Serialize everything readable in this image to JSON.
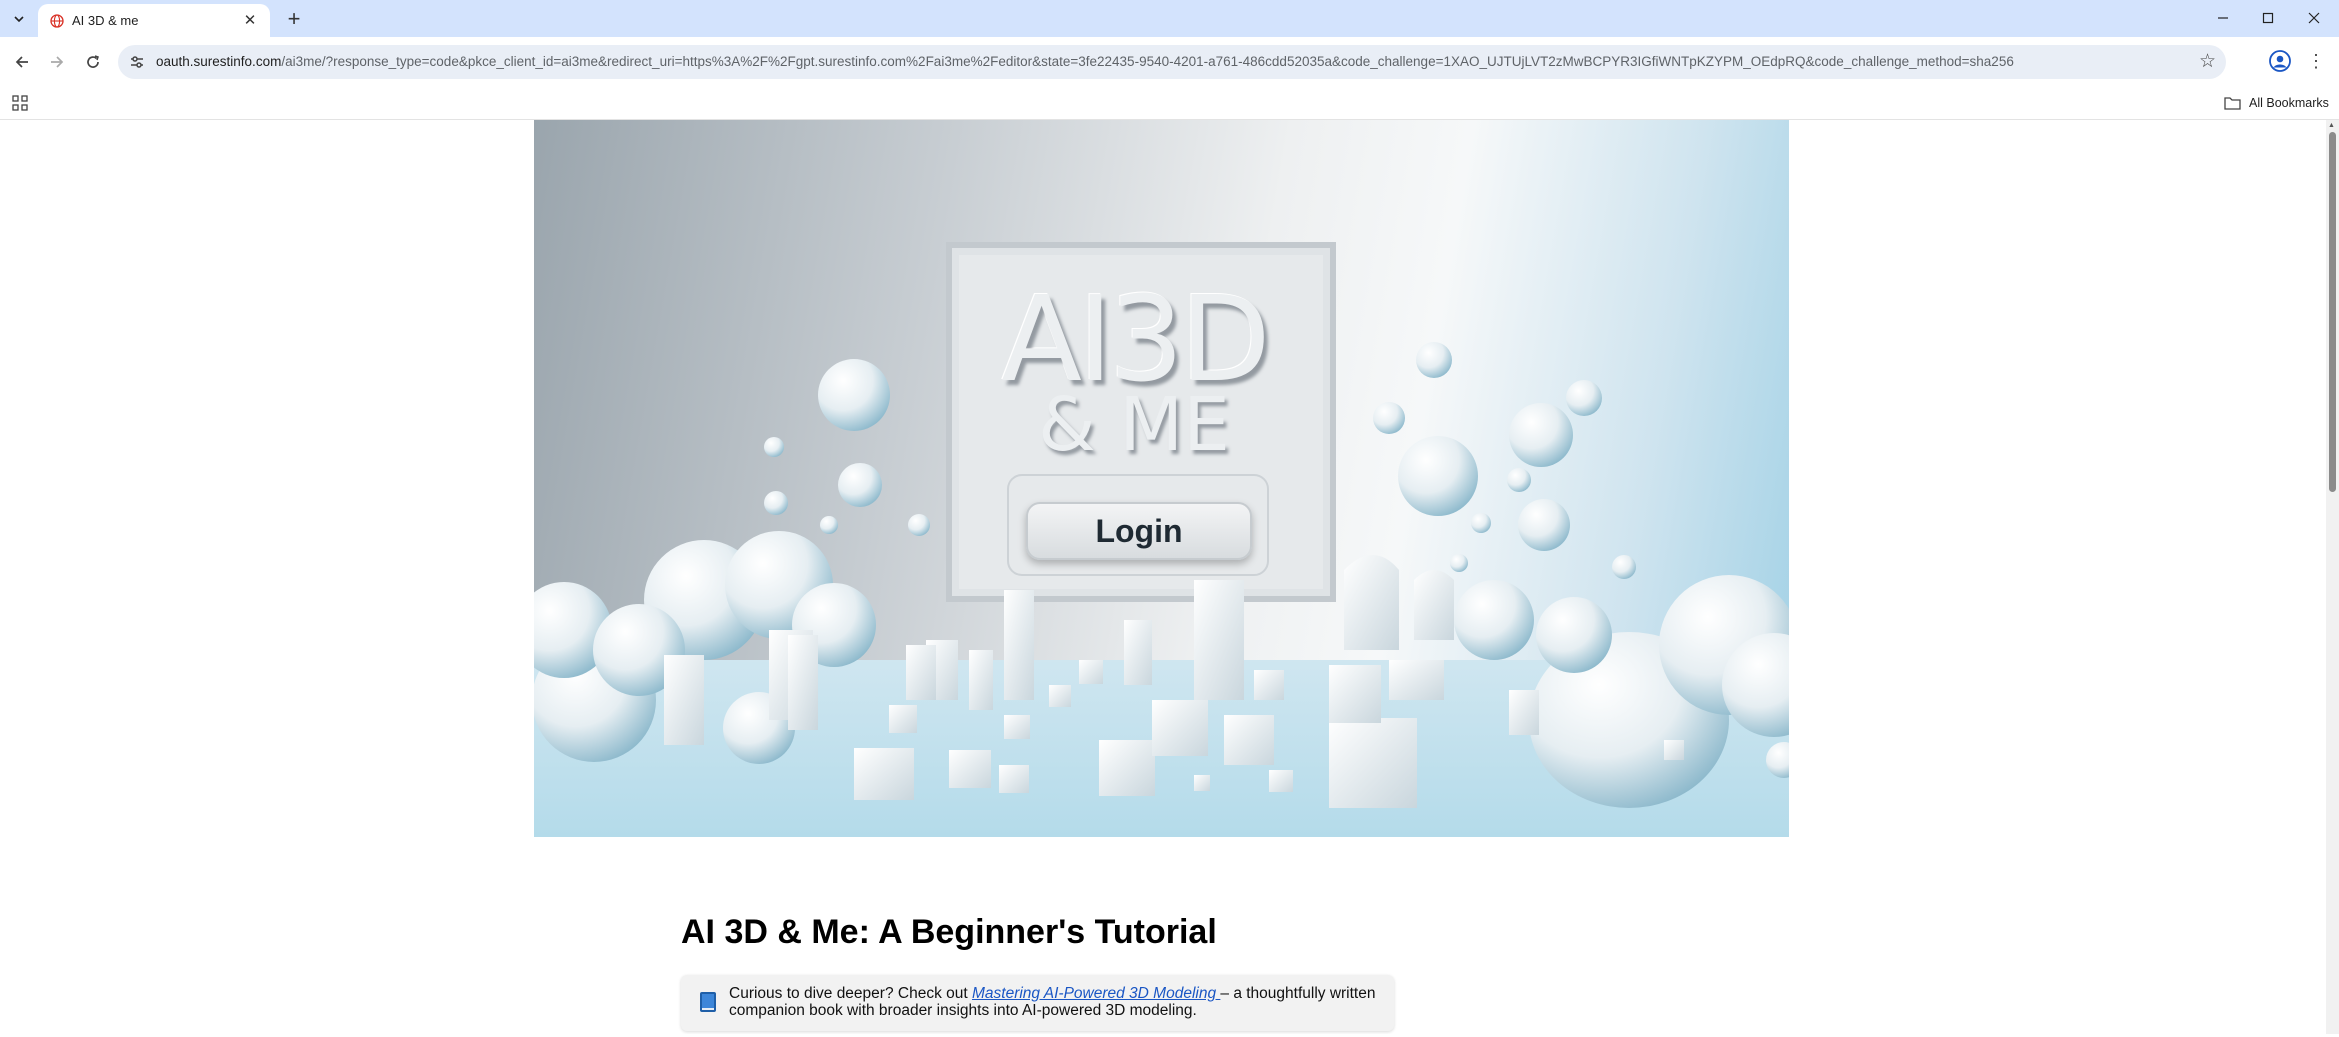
{
  "browser": {
    "tab": {
      "title": "AI 3D & me"
    },
    "url": {
      "host": "oauth.surestinfo.com",
      "path": "/ai3me/?response_type=code&pkce_client_id=ai3me&redirect_uri=https%3A%2F%2Fgpt.surestinfo.com%2Fai3me%2Feditor&state=3fe22435-9540-4201-a761-486cdd52035a&code_challenge=1XAO_UJTUjLVT2zMwBCPYR3IGfiWNTpKZYPM_OEdpRQ&code_challenge_method=sha256"
    },
    "bookmarks": {
      "all_label": "All Bookmarks"
    },
    "icons": {
      "tab_search": "chevron-down-icon",
      "favicon": "globe-icon",
      "tab_close": "close-icon",
      "new_tab": "plus-icon",
      "back": "back-arrow-icon",
      "forward": "forward-arrow-icon",
      "reload": "reload-icon",
      "site_info": "tune-icon",
      "bookmark_star": "star-icon",
      "profile": "profile-icon",
      "menu": "kebab-menu-icon",
      "apps": "apps-grid-icon",
      "folder": "folder-icon"
    }
  },
  "hero": {
    "title": "AI3D",
    "subtitle": "& ME",
    "login_label": "Login"
  },
  "page": {
    "title": "AI 3D & Me: A Beginner's Tutorial",
    "callout": {
      "icon": "book-icon",
      "text_before": "Curious to dive deeper? Check out ",
      "link_text": "Mastering AI-Powered 3D Modeling ",
      "text_after": " – a thoughtfully written companion book with broader insights into AI-powered 3D modeling."
    }
  },
  "colors": {
    "tabstrip": "#d3e3fd",
    "omnibox": "#e9eef6",
    "link": "#1a56c4",
    "hero_accent": "#9fd0e5"
  }
}
